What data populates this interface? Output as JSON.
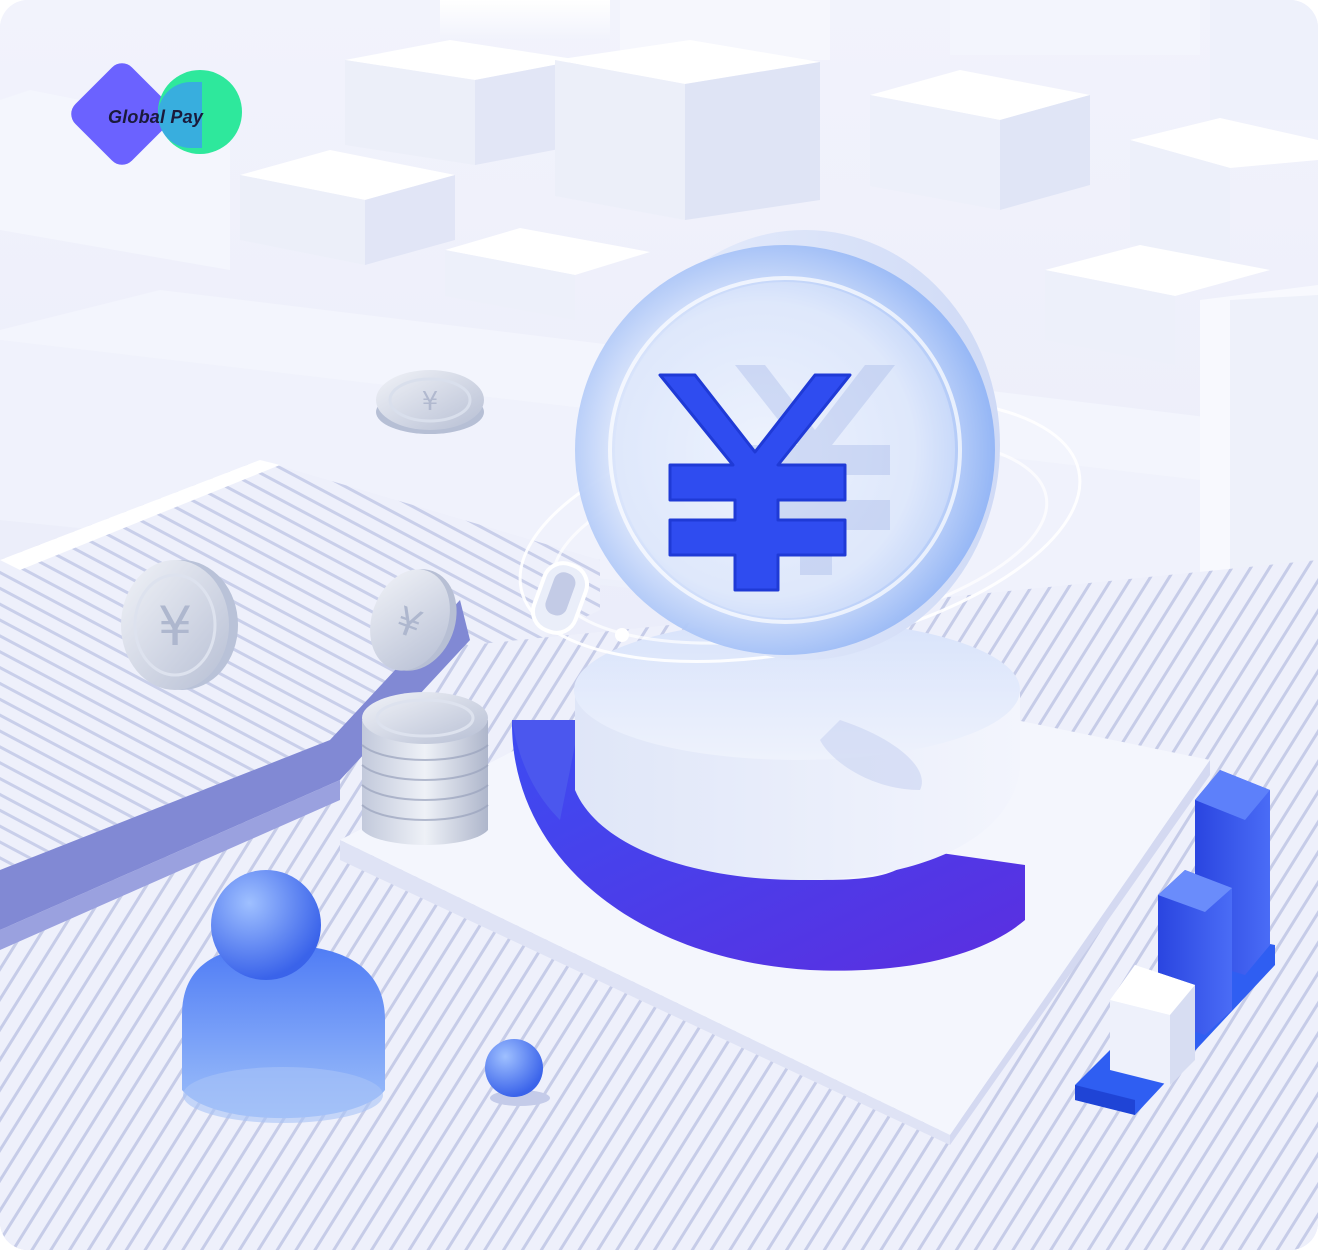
{
  "brand": {
    "name": "Global Pay",
    "diamond_color": "#6b62ff",
    "circle_color": "#2ee89c",
    "overlap_color": "#3aa7e6"
  },
  "illustration": {
    "currency_symbol": "¥",
    "accent_color": "#2f4cf0",
    "secondary_color": "#5a7cff",
    "coin_silver": "#c9d0e2"
  }
}
